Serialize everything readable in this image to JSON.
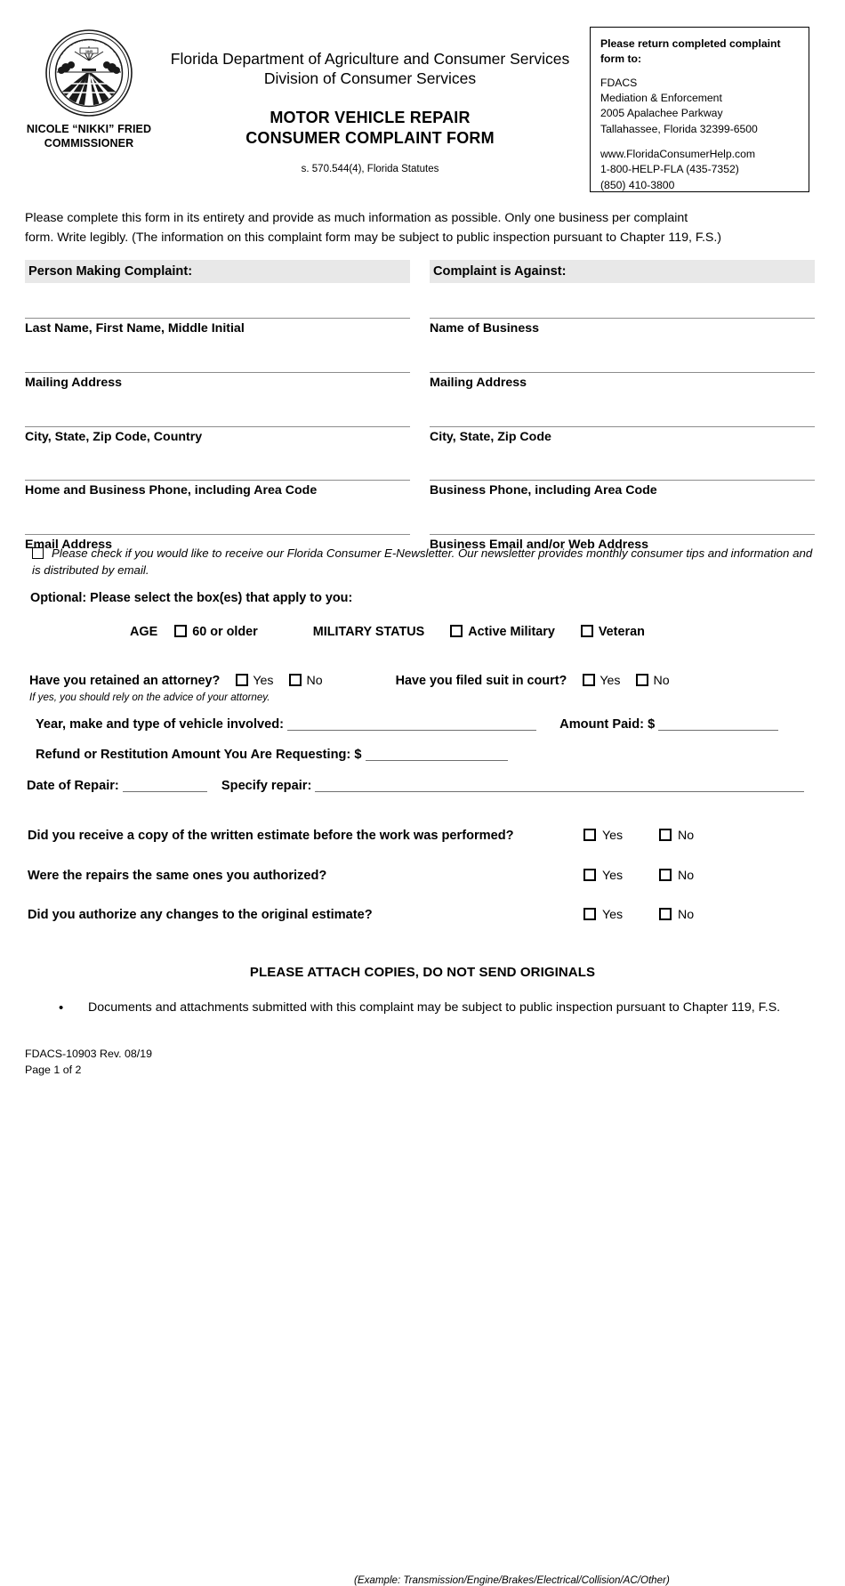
{
  "header": {
    "seal_alt": "florida-department-of-agriculture-and-consumer-services-seal",
    "commissioner_name": "NICOLE “NIKKI” FRIED",
    "commissioner_title": "COMMISSIONER",
    "department_line": "Florida Department of Agriculture and Consumer Services",
    "division_line": "Division of Consumer Services",
    "form_title_line1": "MOTOR VEHICLE REPAIR",
    "form_title_line2": "CONSUMER COMPLAINT FORM",
    "statute": "s. 570.544(4), Florida Statutes"
  },
  "return_box": {
    "title": "Please return completed complaint form to:",
    "agency": "FDACS",
    "division": "Mediation & Enforcement",
    "street": "2005 Apalachee Parkway",
    "city_state_zip": "Tallahassee, Florida 32399-6500",
    "website": "www.FloridaConsumerHelp.com",
    "toll_free": "1-800-HELP-FLA (435-7352)",
    "phone": "(850) 410-3800"
  },
  "intro": {
    "line1": "Please complete this form in its entirety and provide as much information as possible.  Only one business per complaint",
    "line2": "form.  Write legibly.  (The information on this complaint form may be subject to public inspection pursuant to Chapter 119, F.S.)"
  },
  "complainant": {
    "section_title": "Person Making Complaint:",
    "fields": [
      {
        "label": "Last Name, First Name, Middle Initial",
        "value": ""
      },
      {
        "label": "Mailing Address",
        "value": ""
      },
      {
        "label": "City, State, Zip Code, Country",
        "value": ""
      },
      {
        "label": "Home and Business Phone, including Area Code",
        "value": ""
      },
      {
        "label": "Email Address",
        "value": ""
      }
    ]
  },
  "business": {
    "section_title": "Complaint is Against:",
    "fields": [
      {
        "label": "Name of Business",
        "value": ""
      },
      {
        "label": "Mailing Address",
        "value": ""
      },
      {
        "label": "City, State, Zip Code",
        "value": ""
      },
      {
        "label": "Business Phone, including Area Code",
        "value": ""
      },
      {
        "label": "Business Email and/or Web Address",
        "value": ""
      }
    ]
  },
  "newsletter": {
    "text": "Please check if you would like to receive our Florida Consumer E-Newsletter.  Our newsletter provides monthly consumer tips and information and is distributed by email.",
    "checked": false
  },
  "optional": {
    "title": "Optional: Please select the box(es) that apply to you:",
    "age_label": "AGE",
    "age_option": "60 or older",
    "military_label": "MILITARY STATUS",
    "military_option_1": "Active Military",
    "military_option_2": "Veteran"
  },
  "legal": {
    "attorney_question": "Have you retained an attorney?",
    "attorney_yes": "Yes",
    "attorney_no": "No",
    "attorney_note": "If yes, you should rely on the advice of your attorney.",
    "suit_question": "Have you filed suit in court?",
    "suit_yes": "Yes",
    "suit_no": "No"
  },
  "vehicle": {
    "vehicle_label": "Year, make and type of vehicle involved:",
    "vehicle_value": "",
    "amount_paid_label": "Amount Paid: $",
    "amount_paid_value": "",
    "refund_label": "Refund or Restitution Amount You Are Requesting: $",
    "refund_value": "",
    "date_label": "Date of Repair:",
    "date_value": "",
    "specify_label": "Specify repair:",
    "specify_value": "",
    "example_note": "(Example: Transmission/Engine/Brakes/Electrical/Collision/AC/Other)"
  },
  "questions": [
    {
      "text": "Did you receive a copy of the written estimate before the work was performed?",
      "yes": "Yes",
      "no": "No"
    },
    {
      "text": "Were the repairs the same ones you authorized?",
      "yes": "Yes",
      "no": "No"
    },
    {
      "text": "Did you authorize any changes to the original estimate?",
      "yes": "Yes",
      "no": "No"
    }
  ],
  "footer": {
    "attach_notice": "PLEASE ATTACH COPIES, DO NOT SEND ORIGINALS",
    "bullet_marker": "•",
    "bullet_text": "Documents and attachments submitted with this complaint may be subject to public inspection pursuant to Chapter 119, F.S.",
    "form_number": "FDACS-10903 Rev. 08/19",
    "page_number": "Page 1 of 2"
  },
  "colors": {
    "section_bar_bg": "#e8e8e8",
    "rule": "#8d8d8d",
    "text": "#000000"
  }
}
